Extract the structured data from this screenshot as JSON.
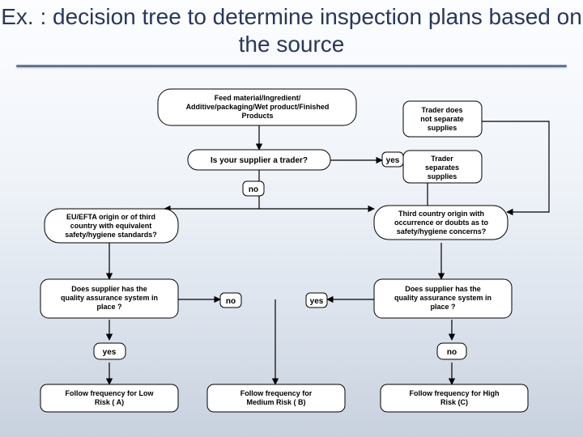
{
  "title": "Ex. : decision tree to determine inspection plans based on the source",
  "nodes": {
    "n1": "Feed material/Ingredient/\nAdditive/packaging/Wet product/Finished\nProducts",
    "n2": "Is your supplier a trader?",
    "side_top": "Trader does\nnot separate\nsupplies",
    "side_bot": "Trader\nseparates\nsupplies",
    "n3a": "EU/EFTA origin or of third\ncountry with equivalent\nsafety/hygiene standards?",
    "n3b": "Third country origin with\noccurrence or doubts as to\nsafety/hygiene concerns?",
    "n4a": "Does supplier has the\nquality assurance system in\nplace ?",
    "n4b": "Does supplier has the\nquality assurance system in\nplace ?",
    "outA": "Follow frequency for Low\nRisk ( A)",
    "outB": "Follow frequency for\nMedium Risk ( B)",
    "outC": "Follow frequency for High\nRisk (C)"
  },
  "labels": {
    "yes": "yes",
    "no": "no"
  }
}
